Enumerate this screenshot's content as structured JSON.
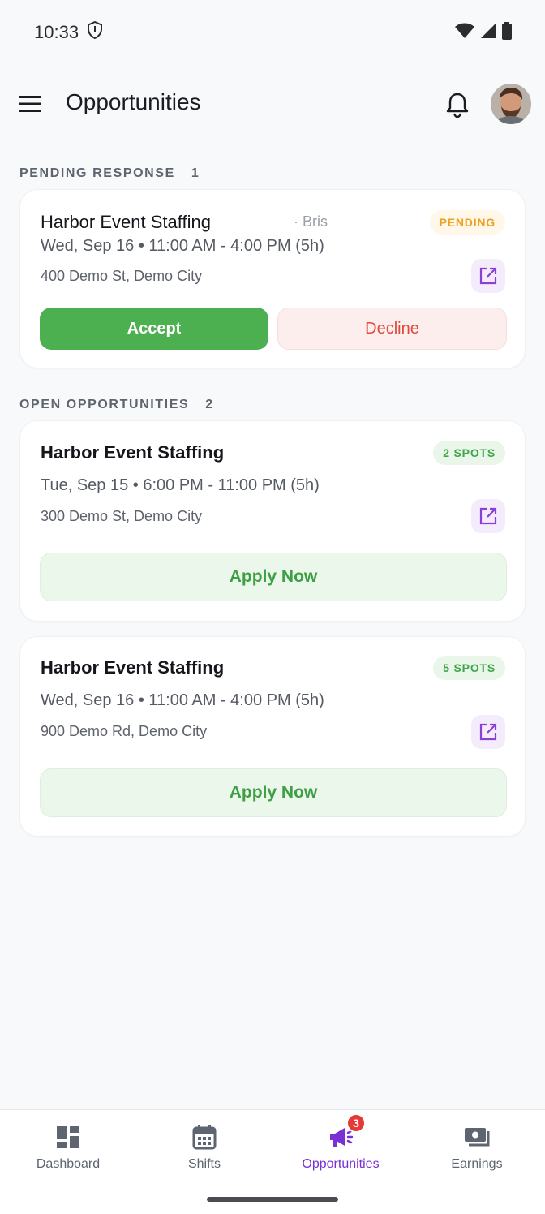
{
  "status_bar": {
    "time": "10:33"
  },
  "app_bar": {
    "title": "Opportunities"
  },
  "pending_section": {
    "label": "PENDING RESPONSE",
    "count": "1",
    "cards": [
      {
        "title": "Harbor Event Staffing",
        "sub": "· Bris",
        "badge": "PENDING",
        "time": "Wed, Sep 16 • 11:00 AM - 4:00 PM (5h)",
        "address": "400 Demo St, Demo City",
        "accept_label": "Accept",
        "decline_label": "Decline"
      }
    ]
  },
  "open_section": {
    "label": "OPEN OPPORTUNITIES",
    "count": "2",
    "cards": [
      {
        "title": "Harbor Event Staffing",
        "badge": "2 SPOTS",
        "time": "Tue, Sep 15 • 6:00 PM - 11:00 PM (5h)",
        "address": "300 Demo St, Demo City",
        "apply_label": "Apply Now"
      },
      {
        "title": "Harbor Event Staffing",
        "badge": "5 SPOTS",
        "time": "Wed, Sep 16 • 11:00 AM - 4:00 PM (5h)",
        "address": "900 Demo Rd, Demo City",
        "apply_label": "Apply Now"
      }
    ]
  },
  "bottom_nav": {
    "items": [
      {
        "label": "Dashboard",
        "icon": "dashboard-icon"
      },
      {
        "label": "Shifts",
        "icon": "calendar-icon"
      },
      {
        "label": "Opportunities",
        "icon": "megaphone-icon",
        "badge": "3",
        "active": true
      },
      {
        "label": "Earnings",
        "icon": "money-icon"
      }
    ]
  },
  "colors": {
    "accent": "#7b2fd6",
    "accept": "#4caf50",
    "decline_text": "#e0493d",
    "pending": "#f0a020",
    "spots": "#3ea64a"
  }
}
